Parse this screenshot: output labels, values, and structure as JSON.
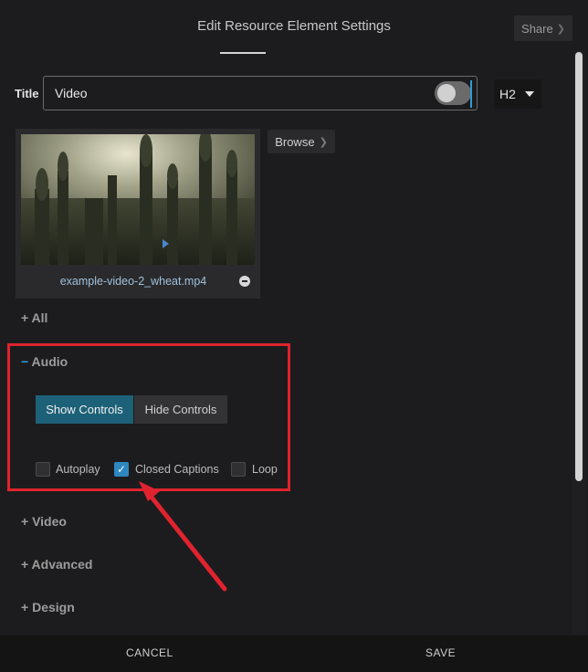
{
  "header": {
    "title": "Edit Resource Element Settings",
    "share_label": "Share"
  },
  "title_row": {
    "label": "Title",
    "value": "Video",
    "heading_level": "H2"
  },
  "media": {
    "browse_label": "Browse",
    "filename": "example-video-2_wheat.mp4"
  },
  "sections": {
    "all": "All",
    "audio": "Audio",
    "video": "Video",
    "advanced": "Advanced",
    "design": "Design"
  },
  "audio": {
    "show_controls": "Show Controls",
    "hide_controls": "Hide Controls",
    "autoplay": "Autoplay",
    "closed_captions": "Closed Captions",
    "loop": "Loop",
    "closed_captions_checked": true
  },
  "footer": {
    "cancel": "CANCEL",
    "save": "SAVE"
  },
  "colors": {
    "accent": "#1d6178",
    "highlight": "#e0232e",
    "checkbox": "#2f87c0"
  }
}
